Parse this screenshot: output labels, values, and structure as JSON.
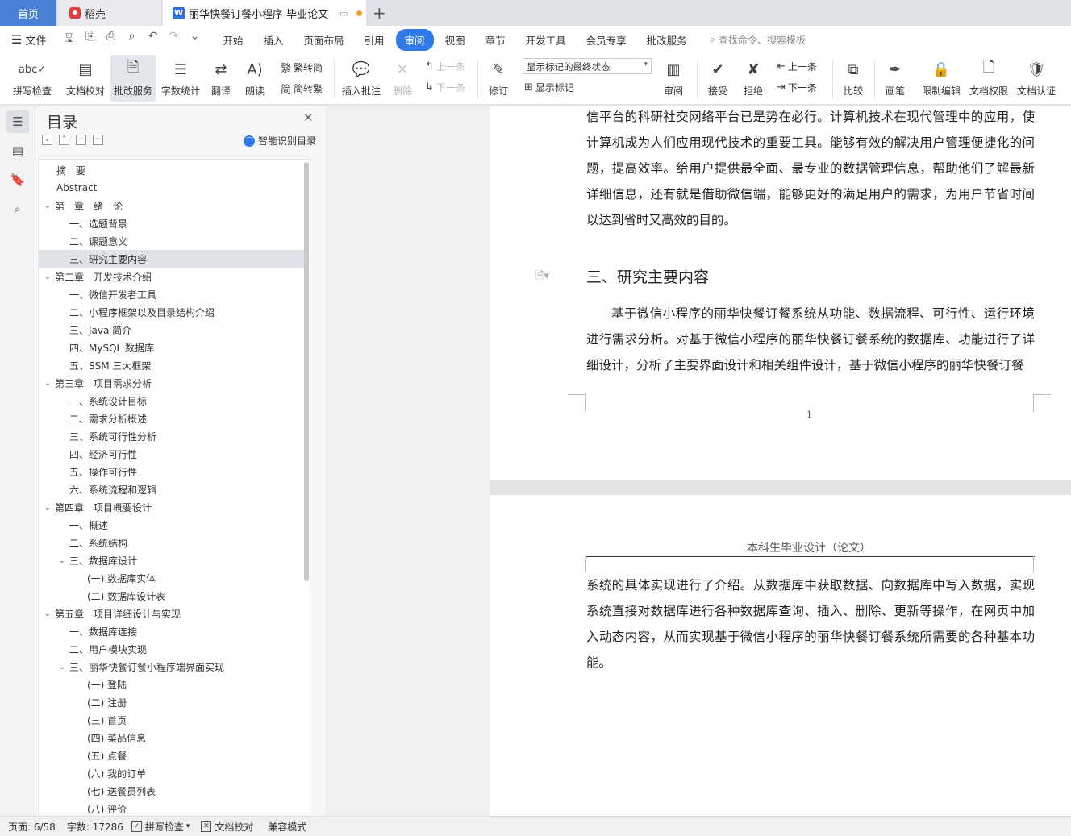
{
  "tabs": {
    "home": "首页",
    "daoke": "稻壳",
    "document": "丽华快餐订餐小程序 毕业论文"
  },
  "menu": {
    "file": "文件",
    "items": [
      "开始",
      "插入",
      "页面布局",
      "引用",
      "审阅",
      "视图",
      "章节",
      "开发工具",
      "会员专享",
      "批改服务"
    ],
    "active": "审阅",
    "search_placeholder": "查找命令、搜索模板"
  },
  "ribbon": {
    "spell_check": "拼写检查",
    "doc_proof": "文档校对",
    "review_service": "批改服务",
    "word_count": "字数统计",
    "translate": "翻译",
    "read_aloud": "朗读",
    "trad_to_simp": "繁转简",
    "simp_to_trad": "简转繁",
    "insert_comment": "插入批注",
    "delete": "删除",
    "prev_comment": "上一条",
    "next_comment": "下一条",
    "track_changes": "修订",
    "markup_state": "显示标记的最终状态",
    "show_markup": "显示标记",
    "review_pane": "审阅",
    "accept": "接受",
    "reject": "拒绝",
    "prev_change": "上一条",
    "next_change": "下一条",
    "compare": "比较",
    "ink": "画笔",
    "restrict_edit": "限制编辑",
    "doc_permission": "文档权限",
    "doc_certify": "文档认证"
  },
  "toc": {
    "title": "目录",
    "smart_recognize": "智能识别目录",
    "items": [
      {
        "label": "摘　要",
        "level": 1,
        "caret": ""
      },
      {
        "label": "Abstract",
        "level": 1,
        "caret": ""
      },
      {
        "label": "第一章　绪　论",
        "level": 1,
        "caret": "v"
      },
      {
        "label": "一、选题背景",
        "level": 2,
        "caret": ""
      },
      {
        "label": "二、课题意义",
        "level": 2,
        "caret": ""
      },
      {
        "label": "三、研究主要内容",
        "level": 2,
        "caret": "",
        "selected": true
      },
      {
        "label": "第二章　开发技术介绍",
        "level": 1,
        "caret": "v"
      },
      {
        "label": "一、微信开发者工具",
        "level": 2,
        "caret": ""
      },
      {
        "label": "二、小程序框架以及目录结构介绍",
        "level": 2,
        "caret": ""
      },
      {
        "label": "三、Java 简介",
        "level": 2,
        "caret": ""
      },
      {
        "label": "四、MySQL 数据库",
        "level": 2,
        "caret": ""
      },
      {
        "label": "五、SSM 三大框架",
        "level": 2,
        "caret": ""
      },
      {
        "label": "第三章　项目需求分析",
        "level": 1,
        "caret": "v"
      },
      {
        "label": "一、系统设计目标",
        "level": 2,
        "caret": ""
      },
      {
        "label": "二、需求分析概述",
        "level": 2,
        "caret": ""
      },
      {
        "label": "三、系统可行性分析",
        "level": 2,
        "caret": ""
      },
      {
        "label": "四、经济可行性",
        "level": 2,
        "caret": ""
      },
      {
        "label": "五、操作可行性",
        "level": 2,
        "caret": ""
      },
      {
        "label": "六、系统流程和逻辑",
        "level": 2,
        "caret": ""
      },
      {
        "label": "第四章　项目概要设计",
        "level": 1,
        "caret": "v"
      },
      {
        "label": "一、概述",
        "level": 2,
        "caret": ""
      },
      {
        "label": "二、系统结构",
        "level": 2,
        "caret": ""
      },
      {
        "label": "三、数据库设计",
        "level": 2,
        "caret": "v"
      },
      {
        "label": "(一) 数据库实体",
        "level": 3,
        "caret": ""
      },
      {
        "label": "(二) 数据库设计表",
        "level": 3,
        "caret": ""
      },
      {
        "label": "第五章　项目详细设计与实现",
        "level": 1,
        "caret": "v"
      },
      {
        "label": "一、数据库连接",
        "level": 2,
        "caret": ""
      },
      {
        "label": "二、用户模块实现",
        "level": 2,
        "caret": ""
      },
      {
        "label": "三、丽华快餐订餐小程序端界面实现",
        "level": 2,
        "caret": "v"
      },
      {
        "label": "(一) 登陆",
        "level": 3,
        "caret": ""
      },
      {
        "label": "(二) 注册",
        "level": 3,
        "caret": ""
      },
      {
        "label": "(三) 首页",
        "level": 3,
        "caret": ""
      },
      {
        "label": "(四) 菜品信息",
        "level": 3,
        "caret": ""
      },
      {
        "label": "(五) 点餐",
        "level": 3,
        "caret": ""
      },
      {
        "label": "(六) 我的订单",
        "level": 3,
        "caret": ""
      },
      {
        "label": "(七) 送餐员列表",
        "level": 3,
        "caret": ""
      },
      {
        "label": "(八) 评价",
        "level": 3,
        "caret": ""
      }
    ]
  },
  "document": {
    "page1_para1": "信平台的科研社交网络平台已是势在必行。计算机技术在现代管理中的应用，使计算机成为人们应用现代技术的重要工具。能够有效的解决用户管理便捷化的问题，提高效率。给用户提供最全面、最专业的数据管理信息，帮助他们了解最新详细信息，还有就是借助微信端，能够更好的满足用户的需求，为用户节省时间以达到省时又高效的目的。",
    "heading": "三、研究主要内容",
    "page1_para2": "基于微信小程序的丽华快餐订餐系统从功能、数据流程、可行性、运行环境进行需求分析。对基于微信小程序的丽华快餐订餐系统的数据库、功能进行了详细设计，分析了主要界面设计和相关组件设计，基于微信小程序的丽华快餐订餐",
    "page_number": "1",
    "page2_header": "本科生毕业设计（论文）",
    "page2_para": "系统的具体实现进行了介绍。从数据库中获取数据、向数据库中写入数据，实现系统直接对数据库进行各种数据库查询、插入、删除、更新等操作，在网页中加入动态内容，从而实现基于微信小程序的丽华快餐订餐系统所需要的各种基本功能。"
  },
  "status": {
    "page": "页面: 6/58",
    "word_count": "字数: 17286",
    "spell_check": "拼写检查",
    "doc_proof": "文档校对",
    "compat_mode": "兼容模式"
  }
}
